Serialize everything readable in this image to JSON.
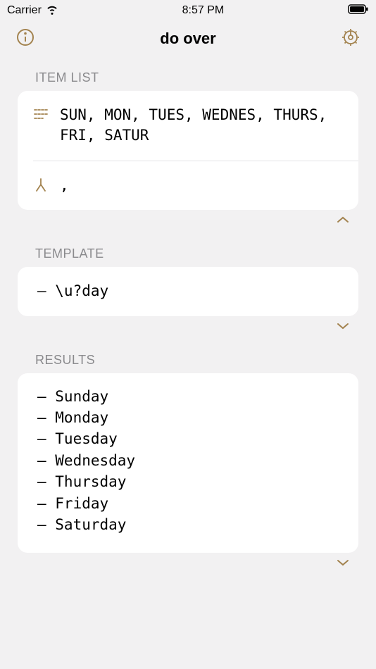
{
  "statusBar": {
    "carrier": "Carrier",
    "time": "8:57 PM"
  },
  "nav": {
    "title": "do over"
  },
  "sections": {
    "itemList": {
      "header": "ITEM LIST",
      "itemsText": "SUN, MON, TUES, WEDNES, THURS, FRI, SATUR",
      "delimiter": ","
    },
    "template": {
      "header": "TEMPLATE",
      "value": "– \\u?day"
    },
    "results": {
      "header": "RESULTS",
      "items": [
        "– Sunday",
        "– Monday",
        "– Tuesday",
        "– Wednesday",
        "– Thursday",
        "– Friday",
        "– Saturday"
      ]
    }
  },
  "colors": {
    "accent": "#a3834f",
    "grayText": "#8a8a8d"
  }
}
